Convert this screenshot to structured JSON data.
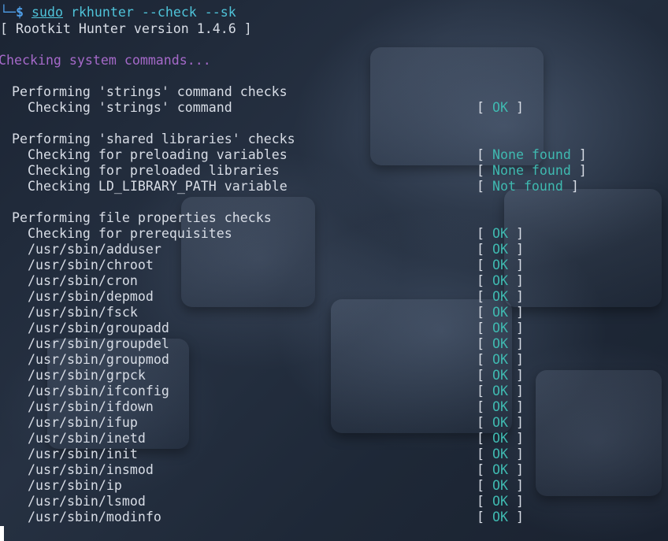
{
  "prompt": {
    "prefix": "└─",
    "symbol": "$",
    "sudo": "sudo",
    "command": "rkhunter --check --sk"
  },
  "version_line": "[ Rootkit Hunter version 1.4.6 ]",
  "section_heading": "Checking system commands...",
  "groups": [
    {
      "title": "Performing 'strings' command checks",
      "checks": [
        {
          "label": "Checking 'strings' command",
          "result": "OK"
        }
      ]
    },
    {
      "title": "Performing 'shared libraries' checks",
      "checks": [
        {
          "label": "Checking for preloading variables",
          "result": "None found"
        },
        {
          "label": "Checking for preloaded libraries",
          "result": "None found"
        },
        {
          "label": "Checking LD_LIBRARY_PATH variable",
          "result": "Not found"
        }
      ]
    },
    {
      "title": "Performing file properties checks",
      "checks": [
        {
          "label": "Checking for prerequisites",
          "result": "OK"
        },
        {
          "label": "/usr/sbin/adduser",
          "result": "OK"
        },
        {
          "label": "/usr/sbin/chroot",
          "result": "OK"
        },
        {
          "label": "/usr/sbin/cron",
          "result": "OK"
        },
        {
          "label": "/usr/sbin/depmod",
          "result": "OK"
        },
        {
          "label": "/usr/sbin/fsck",
          "result": "OK"
        },
        {
          "label": "/usr/sbin/groupadd",
          "result": "OK"
        },
        {
          "label": "/usr/sbin/groupdel",
          "result": "OK"
        },
        {
          "label": "/usr/sbin/groupmod",
          "result": "OK"
        },
        {
          "label": "/usr/sbin/grpck",
          "result": "OK"
        },
        {
          "label": "/usr/sbin/ifconfig",
          "result": "OK"
        },
        {
          "label": "/usr/sbin/ifdown",
          "result": "OK"
        },
        {
          "label": "/usr/sbin/ifup",
          "result": "OK"
        },
        {
          "label": "/usr/sbin/inetd",
          "result": "OK"
        },
        {
          "label": "/usr/sbin/init",
          "result": "OK"
        },
        {
          "label": "/usr/sbin/insmod",
          "result": "OK"
        },
        {
          "label": "/usr/sbin/ip",
          "result": "OK"
        },
        {
          "label": "/usr/sbin/lsmod",
          "result": "OK"
        },
        {
          "label": "/usr/sbin/modinfo",
          "result": "OK"
        }
      ]
    }
  ],
  "colors": {
    "ok": "#3fb9b0",
    "prompt": "#4e9ee8",
    "command": "#4fc3d9",
    "section": "#a569c9",
    "text": "#d8dde6"
  }
}
